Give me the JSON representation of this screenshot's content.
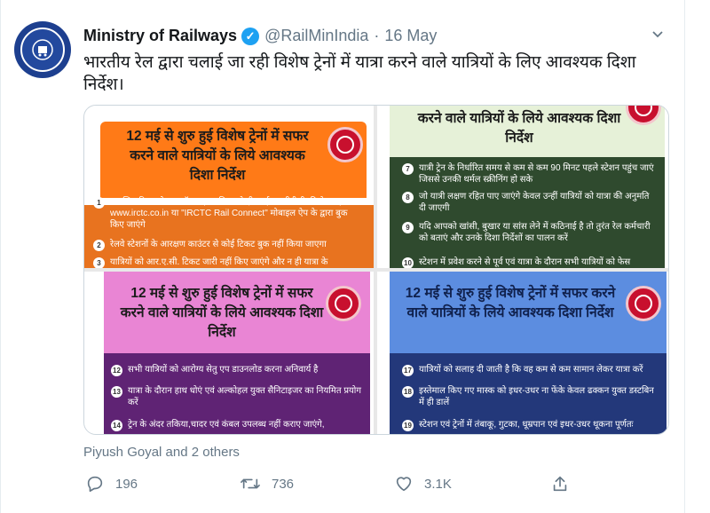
{
  "tweet": {
    "name": "Ministry of Railways",
    "handle": "@RailMinIndia",
    "separator": "·",
    "date": "16 May",
    "text": "भारतीय रेल द्वारा चलाई जा रही विशेष ट्रेनों में यात्रा करने वाले यात्रियों के लिए आवश्यक दिशा निर्देश।",
    "liked_by": "Piyush Goyal and 2 others"
  },
  "media": {
    "panel1": {
      "title": "12 मई से शुरु हुई विशेष ट्रेनों में सफर करने वाले यात्रियों के लिये आवश्यक दिशा निर्देश",
      "items": [
        {
          "num": "1",
          "text": "आरक्षित टिकट केवल ऑनलाइन प्रक्रिया से ही आईआरसीटीसी की वेबसाइट www.irctc.co.in या \"IRCTC Rail Connect\" मोबाइल ऐप के द्वारा बुक किए जाएंगे"
        },
        {
          "num": "2",
          "text": "रेलवे स्टेशनों के आरक्षण काउंटर से कोई टिकट बुक नहीं किया जाएगा"
        },
        {
          "num": "3",
          "text": "यात्रियों को आर.ए.सी. टिकट जारी नहीं किए जाएंगे और न ही यात्रा के"
        }
      ]
    },
    "panel2": {
      "title": "करने वाले यात्रियों के लिये आवश्यक दिशा निर्देश",
      "items": [
        {
          "num": "7",
          "text": "यात्री ट्रेन के निर्धारित समय से कम से कम 90 मिनट पहले स्टेशन पहुंच जाएं जिससे उनकी थर्मल स्क्रीनिंग हो सके"
        },
        {
          "num": "8",
          "text": "जो यात्री लक्षण रहित पाए जाएंगे केवल उन्हीं यात्रियों को यात्रा की अनुमति दी जाएगी"
        },
        {
          "num": "9",
          "text": "यदि आपको खांसी, बुखार या सांस लेने में कठिनाई है तो तुरंत रेल कर्मचारी को बताएं और उनके दिशा निर्देशों का पालन करें"
        },
        {
          "num": "10",
          "text": "स्टेशन में प्रवेश करने से पूर्व एवं यात्रा के दौरान सभी यात्रियों को फेस"
        }
      ]
    },
    "panel3": {
      "title": "12 मई से शुरु हुई विशेष ट्रेनों में सफर करने वाले यात्रियों के लिये आवश्यक दिशा निर्देश",
      "items": [
        {
          "num": "12",
          "text": "सभी यात्रियों को आरोग्य सेतु एप डाउनलोड करना अनिवार्य है"
        },
        {
          "num": "13",
          "text": "यात्रा के दौरान हाथ धोएं एवं अल्कोहल युक्त सैनिटाइजर का नियमित प्रयोग करें"
        },
        {
          "num": "14",
          "text": "ट्रेन के अंदर तकिया,चादर एवं कंबल उपलब्ध नहीं कराए जाएंगे,"
        }
      ]
    },
    "panel4": {
      "title": "12 मई से शुरु हुई विशेष ट्रेनों में सफर करने वाले यात्रियों के लिये आवश्यक दिशा निर्देश",
      "items": [
        {
          "num": "17",
          "text": "यात्रियों को सलाह दी जाती है कि वह कम से कम सामान लेकर यात्रा करें"
        },
        {
          "num": "18",
          "text": "इस्तेमाल किए गए मास्क को इधर-उधर ना फेंके केवल ढक्कन युक्त डस्टबिन में ही डालें"
        },
        {
          "num": "19",
          "text": "स्टेशन एवं ट्रेनों में तंबाकू, गुटका, धूम्रपान एवं इधर-उधर थूकना पूर्णतः"
        }
      ]
    }
  },
  "actions": {
    "replies": "196",
    "retweets": "736",
    "likes": "3.1K"
  },
  "colors": {
    "accent": "#1da1f2",
    "muted": "#657786",
    "orange": "#ff7a17",
    "green_dark": "#2f4a2e",
    "pink": "#e985d4",
    "purple_dark": "#5f2374",
    "blue": "#5c8de0",
    "navy": "#23387a"
  },
  "icons": [
    "verified-badge-icon",
    "chevron-down-icon",
    "reply-icon",
    "retweet-icon",
    "like-icon",
    "share-icon",
    "railway-logo-icon"
  ]
}
